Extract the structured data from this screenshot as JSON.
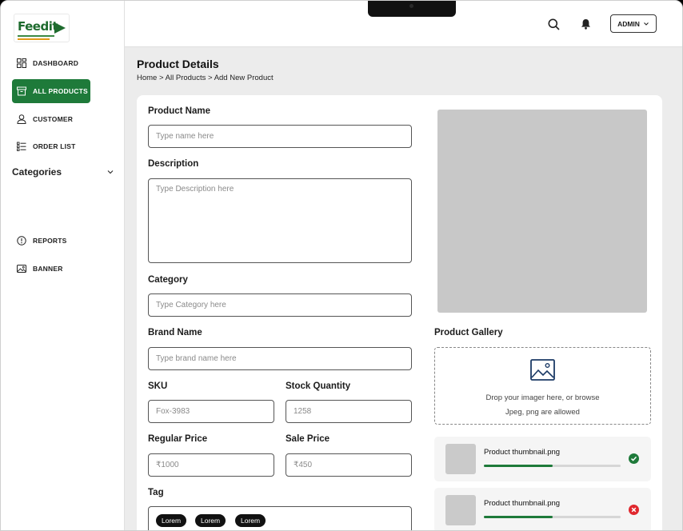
{
  "brand": {
    "logo_text": "Feedit",
    "logo_text_accent": "it"
  },
  "sidebar": {
    "items": [
      {
        "label": "DASHBOARD",
        "icon": "dashboard-icon"
      },
      {
        "label": "ALL PRODUCTS",
        "icon": "archive-box-icon",
        "active": true
      },
      {
        "label": "CUSTOMER",
        "icon": "user-icon"
      },
      {
        "label": "ORDER LIST",
        "icon": "list-icon"
      },
      {
        "label": "REPORTS",
        "icon": "alert-circle-icon"
      },
      {
        "label": "BANNER",
        "icon": "image-icon"
      }
    ],
    "categories_label": "Categories"
  },
  "header": {
    "admin_label": "ADMIN"
  },
  "page": {
    "title": "Product Details",
    "breadcrumb": [
      "Home",
      "All Products",
      "Add New Product"
    ],
    "breadcrumb_sep": ">"
  },
  "form": {
    "product_name": {
      "label": "Product Name",
      "placeholder": "Type name here"
    },
    "description": {
      "label": "Description",
      "placeholder": "Type Description here"
    },
    "category": {
      "label": "Category",
      "placeholder": "Type Category here"
    },
    "brand_name": {
      "label": "Brand Name",
      "placeholder": "Type brand name here"
    },
    "sku": {
      "label": "SKU",
      "placeholder": "Fox-3983"
    },
    "stock_quantity": {
      "label": "Stock Quantity",
      "placeholder": "1258"
    },
    "regular_price": {
      "label": "Regular Price",
      "placeholder": "₹1000"
    },
    "sale_price": {
      "label": "Sale Price",
      "placeholder": "₹450"
    },
    "tag": {
      "label": "Tag",
      "chips": [
        "Lorem",
        "Lorem",
        "Lorem"
      ]
    }
  },
  "gallery": {
    "label": "Product Gallery",
    "drop_text": "Drop your imager here, or browse",
    "allowed_text": "Jpeg, png are allowed",
    "uploads": [
      {
        "name": "Product thumbnail.png",
        "progress": 0.5,
        "status": "success"
      },
      {
        "name": "Product thumbnail.png",
        "progress": 0.5,
        "status": "error"
      }
    ]
  },
  "colors": {
    "accent": "#1e7a3a",
    "success": "#1e7a3a",
    "error": "#e0282e"
  }
}
